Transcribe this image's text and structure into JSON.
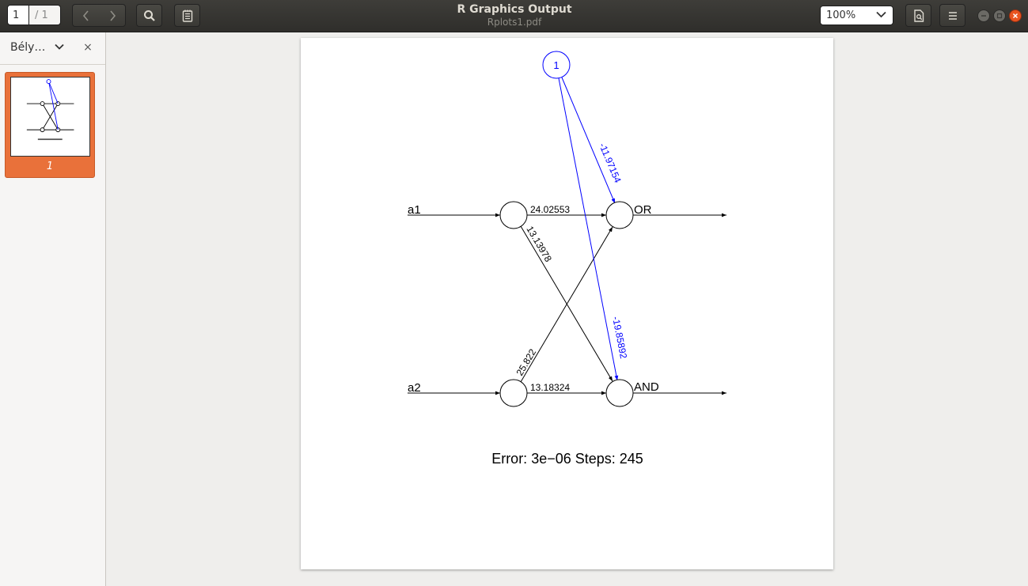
{
  "toolbar": {
    "page_current": "1",
    "page_total": "/ 1",
    "icons": {
      "prev": "chevron-left-icon",
      "next": "chevron-right-icon",
      "search": "search-icon",
      "annotations": "notepad-icon",
      "document": "document-icon",
      "menu": "hamburger-menu-icon"
    },
    "zoom": "100%"
  },
  "window": {
    "title": "R Graphics Output",
    "subtitle": "Rplots1.pdf",
    "controls": [
      "minimize-icon",
      "maximize-icon",
      "close-icon"
    ]
  },
  "sidebar": {
    "title": "Bély…",
    "close_label": "×",
    "thumbnails": [
      {
        "label": "1"
      }
    ]
  },
  "document": {
    "inputs": [
      {
        "label": "a1"
      },
      {
        "label": "a2"
      }
    ],
    "outputs": [
      {
        "label": "OR"
      },
      {
        "label": "AND"
      }
    ],
    "bias_label": "1",
    "weights": {
      "a1_or": "24.02553",
      "a1_and": "13.13978",
      "a2_or": "25.822",
      "a2_and": "13.18324",
      "bias_or": "-11.97154",
      "bias_and": "-19.85892"
    },
    "footer": "Error: 3e−06   Steps: 245",
    "colors": {
      "bias": "#0000ff",
      "edges": "#000000"
    }
  }
}
